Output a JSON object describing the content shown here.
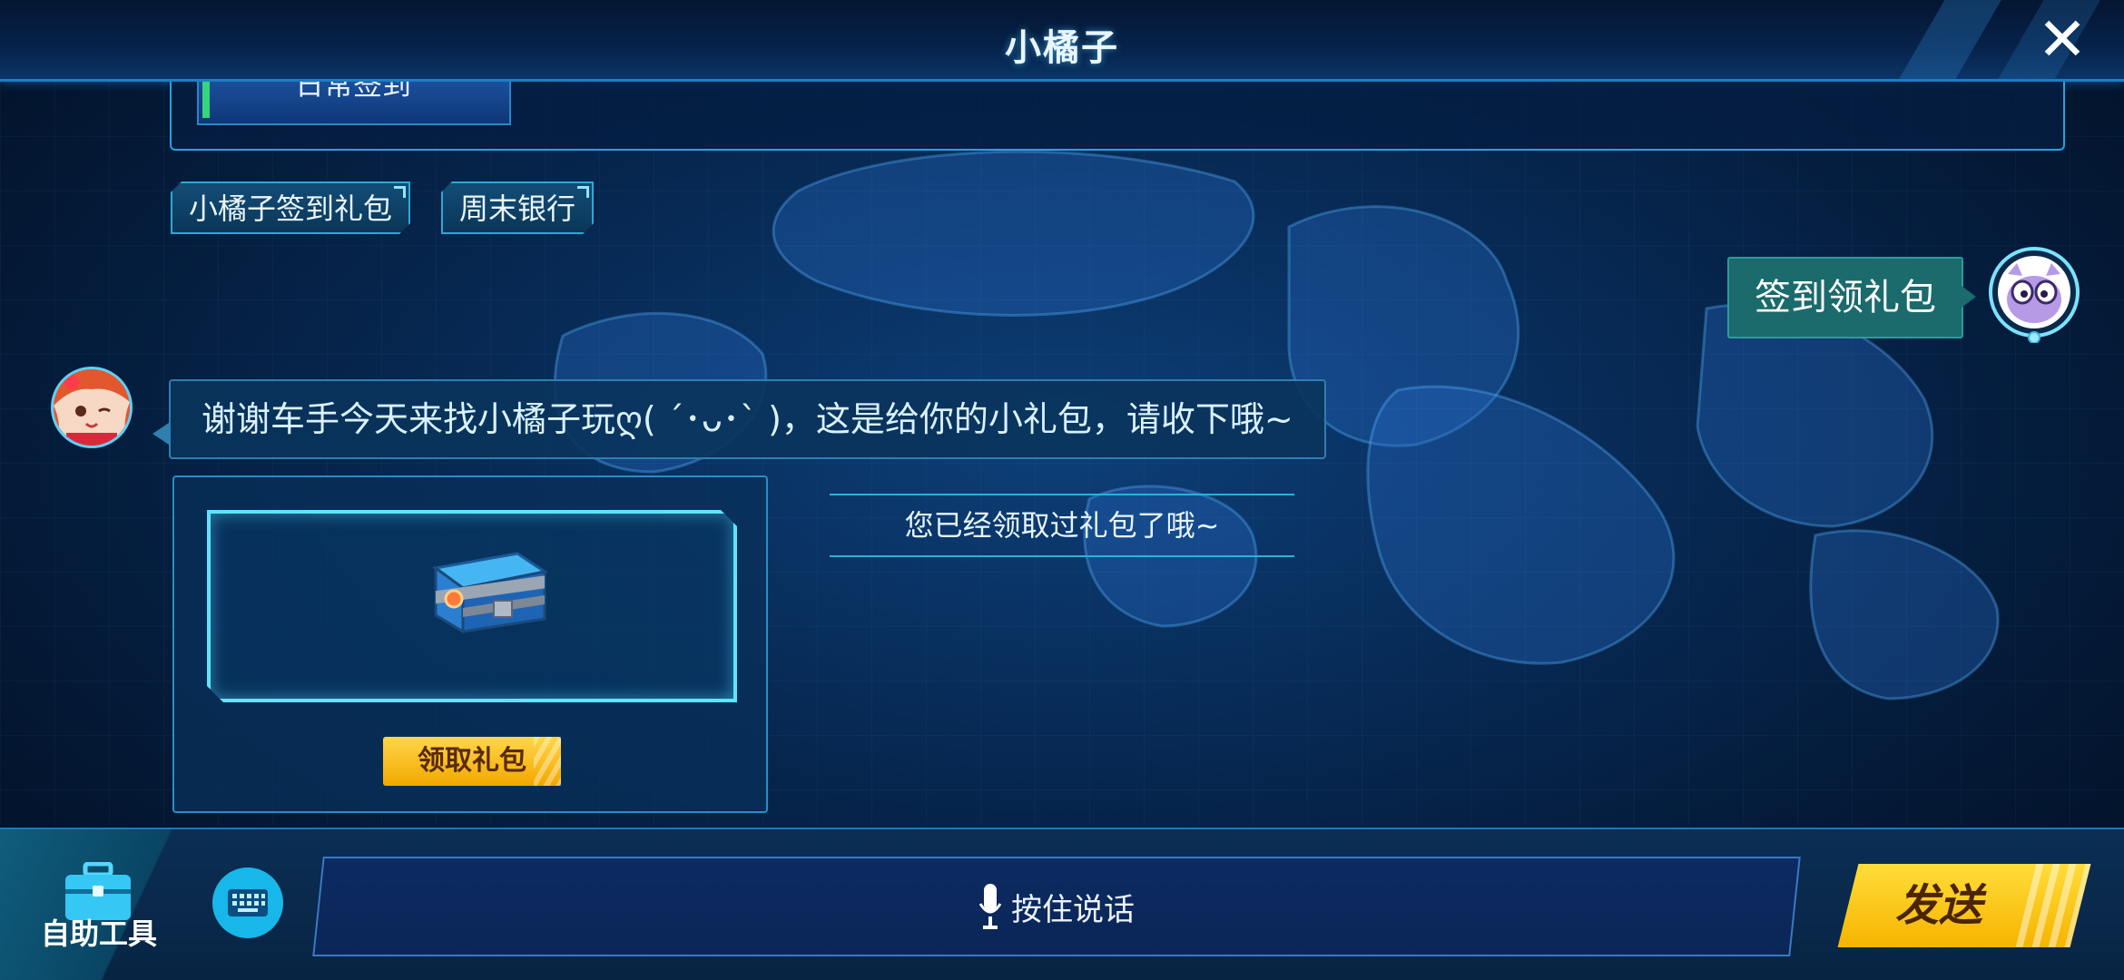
{
  "header": {
    "title": "小橘子",
    "close_icon": "close-icon"
  },
  "top_panel": {
    "partial_button_label": "日常签到"
  },
  "quick_chips": [
    {
      "label": "小橘子签到礼包"
    },
    {
      "label": "周末银行"
    }
  ],
  "conversation": {
    "user_message": "签到领礼包",
    "bot_message": "谢谢车手今天来找小橘子玩ღ( ´･ᴗ･` )，这是给你的小礼包，请收下哦~",
    "gift": {
      "icon": "treasure-chest-icon",
      "claim_button_label": "领取礼包"
    },
    "status_notice": "您已经领取过礼包了哦~"
  },
  "bottom_bar": {
    "tools_label": "自助工具",
    "tools_icon": "toolbox-icon",
    "keyboard_icon": "keyboard-icon",
    "voice_label": "按住说话",
    "mic_icon": "microphone-icon",
    "send_label": "发送"
  },
  "colors": {
    "accent_cyan": "#2aa9d9",
    "send_yellow": "#ffd64a",
    "user_bubble": "#1b6a6c",
    "background": "#072a55"
  }
}
